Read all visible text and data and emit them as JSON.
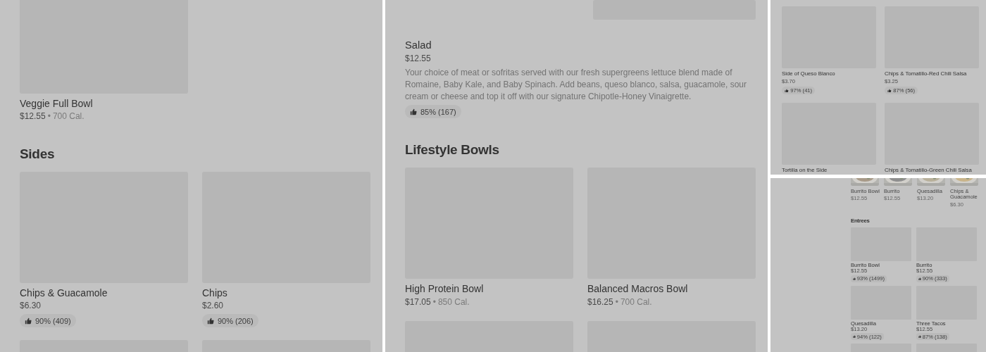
{
  "panels": [
    {
      "blocks": [
        {
          "kind": "grid",
          "items": [
            {
              "name": "Veggie Full Bowl",
              "price": "$12.55",
              "separator": "•",
              "calories": "700 Cal."
            }
          ]
        },
        {
          "kind": "heading",
          "title": "Sides"
        },
        {
          "kind": "grid",
          "more_below": true,
          "items": [
            {
              "name": "Chips & Guacamole",
              "price": "$6.30",
              "rating": "90% (409)"
            },
            {
              "name": "Chips",
              "price": "$2.60",
              "rating": "90% (206)"
            }
          ]
        }
      ]
    },
    {
      "blocks": [
        {
          "kind": "detail",
          "name": "Salad",
          "price": "$12.55",
          "description": "Your choice of meat or sofritas served with our fresh supergreens lettuce blend made of Romaine, Baby Kale, and Baby Spinach. Add beans, queso blanco, salsa, guacamole, sour cream or cheese and top it off with our signature Chipotle-Honey Vinaigrette.",
          "rating": "85% (167)"
        },
        {
          "kind": "heading",
          "title": "Lifestyle Bowls"
        },
        {
          "kind": "grid",
          "more_below": true,
          "items": [
            {
              "name": "High Protein Bowl",
              "price": "$17.05",
              "separator": "•",
              "calories": "850 Cal."
            },
            {
              "name": "Balanced Macros Bowl",
              "price": "$16.25",
              "separator": "•",
              "calories": "700 Cal."
            }
          ]
        }
      ]
    },
    {
      "blocks": [
        {
          "kind": "grid",
          "items": [
            {
              "name": "Side of Queso Blanco",
              "price": "$3.70",
              "rating": "97% (41)"
            },
            {
              "name": "Chips & Tomatillo-Red Chili Salsa",
              "price": "$3.25",
              "rating": "87% (56)"
            },
            {
              "name": "Tortilla on the Side"
            },
            {
              "name": "Chips & Tomatillo-Green Chili Salsa"
            }
          ]
        }
      ]
    },
    {
      "blocks": [
        {
          "kind": "carousel",
          "items": [
            {
              "name": "Burrito Bowl",
              "price": "$12.55"
            },
            {
              "name": "Burrito",
              "price": "$12.55"
            },
            {
              "name": "Quesadilla",
              "price": "$13.20"
            },
            {
              "name": "Chips & Guacamole",
              "price": "$6.30"
            }
          ]
        },
        {
          "kind": "heading",
          "title": "Entrees"
        },
        {
          "kind": "grid",
          "items": [
            {
              "name": "Burrito Bowl",
              "price": "$12.55",
              "rating": "93% (1499)"
            },
            {
              "name": "Burrito",
              "price": "$12.55",
              "rating": "90% (333)"
            },
            {
              "name": "Quesadilla",
              "price": "$13.20",
              "rating": "94% (122)"
            },
            {
              "name": "Three Tacos",
              "price": "$12.55",
              "rating": "87% (138)"
            }
          ],
          "more_below": true
        }
      ]
    }
  ]
}
